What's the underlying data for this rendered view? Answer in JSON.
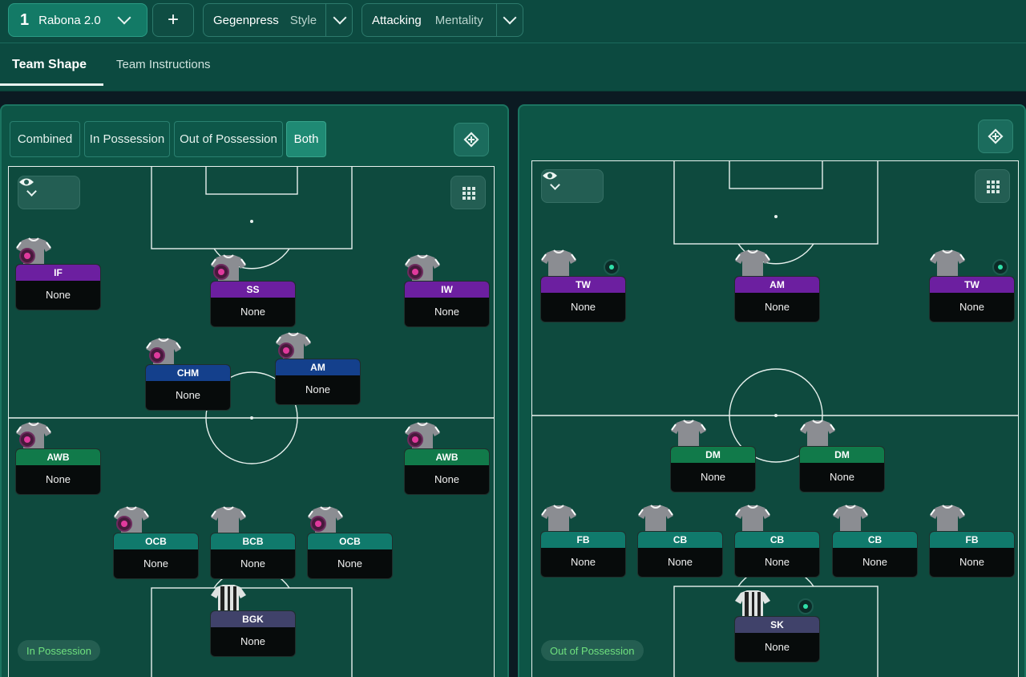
{
  "topbar": {
    "tactic_number": "1",
    "tactic_name": "Rabona 2.0",
    "add_label": "+",
    "style_value": "Gegenpress",
    "style_label": "Style",
    "mentality_value": "Attacking",
    "mentality_label": "Mentality"
  },
  "tabs": {
    "team_shape": "Team Shape",
    "team_instructions": "Team Instructions"
  },
  "modes": {
    "combined": "Combined",
    "in_possession": "In Possession",
    "out_of_possession": "Out of Possession",
    "both": "Both"
  },
  "left_pitch": {
    "phase_label": "In Possession",
    "players": [
      {
        "role": "IF",
        "name": "None",
        "color": "#6c1fa0"
      },
      {
        "role": "SS",
        "name": "None",
        "color": "#6c1fa0"
      },
      {
        "role": "IW",
        "name": "None",
        "color": "#6c1fa0"
      },
      {
        "role": "CHM",
        "name": "None",
        "color": "#14408c"
      },
      {
        "role": "AM",
        "name": "None",
        "color": "#14408c"
      },
      {
        "role": "AWB",
        "name": "None",
        "color": "#117a4a"
      },
      {
        "role": "AWB",
        "name": "None",
        "color": "#117a4a"
      },
      {
        "role": "OCB",
        "name": "None",
        "color": "#107a6c"
      },
      {
        "role": "BCB",
        "name": "None",
        "color": "#107a6c"
      },
      {
        "role": "OCB",
        "name": "None",
        "color": "#107a6c"
      },
      {
        "role": "BGK",
        "name": "None",
        "color": "#40426a"
      }
    ]
  },
  "right_pitch": {
    "phase_label": "Out of Possession",
    "players": [
      {
        "role": "TW",
        "name": "None",
        "color": "#6c1fa0"
      },
      {
        "role": "AM",
        "name": "None",
        "color": "#6c1fa0"
      },
      {
        "role": "TW",
        "name": "None",
        "color": "#6c1fa0"
      },
      {
        "role": "DM",
        "name": "None",
        "color": "#117a4a"
      },
      {
        "role": "DM",
        "name": "None",
        "color": "#117a4a"
      },
      {
        "role": "FB",
        "name": "None",
        "color": "#107a6c"
      },
      {
        "role": "CB",
        "name": "None",
        "color": "#107a6c"
      },
      {
        "role": "CB",
        "name": "None",
        "color": "#107a6c"
      },
      {
        "role": "CB",
        "name": "None",
        "color": "#107a6c"
      },
      {
        "role": "FB",
        "name": "None",
        "color": "#107a6c"
      },
      {
        "role": "SK",
        "name": "None",
        "color": "#40426a"
      }
    ]
  },
  "icons": {
    "eye": "eye-icon",
    "grid": "grid-icon",
    "swap": "swap-icon",
    "chevron": "chevron-down-icon",
    "instruction": "instruction-icon"
  }
}
